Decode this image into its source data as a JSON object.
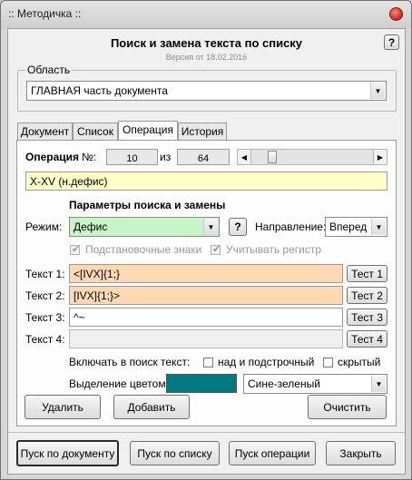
{
  "window": {
    "title": ":: Методичка ::"
  },
  "header": {
    "title": "Поиск и замена текста по списку",
    "version": "Версия от 18.02.2016",
    "help_label": "?"
  },
  "scope": {
    "group_label": "Область",
    "value": "ГЛАВНАЯ часть документа"
  },
  "tabs": [
    {
      "label": "Документ"
    },
    {
      "label": "Список"
    },
    {
      "label": "Операция"
    },
    {
      "label": "История"
    }
  ],
  "operation": {
    "label": "Операция",
    "number_label": "№:",
    "current": "10",
    "of_label": "из",
    "total": "64",
    "slider_fraction": 0.14,
    "name": "X-XV (н.дефис)"
  },
  "params": {
    "title": "Параметры поиска и замены",
    "mode_label": "Режим:",
    "mode_value": "Дефис",
    "help_label": "?",
    "direction_label": "Направление:",
    "direction_value": "Вперед",
    "wildcards_label": "Подстановочные знаки",
    "match_case_label": "Учитывать регистр"
  },
  "texts": [
    {
      "label": "Текст 1:",
      "value": "<[IVX]{1;}",
      "test_label": "Тест 1"
    },
    {
      "label": "Текст 2:",
      "value": "[IVX]{1;}>",
      "test_label": "Тест 2"
    },
    {
      "label": "Текст 3:",
      "value": "^~",
      "test_label": "Тест 3"
    },
    {
      "label": "Текст 4:",
      "value": "",
      "test_label": "Тест 4"
    }
  ],
  "include": {
    "label": "Включать в поиск текст:",
    "superscript_label": "над и подстрочный",
    "hidden_label": "скрытый"
  },
  "highlight": {
    "label": "Выделение цветом:",
    "swatch_color": "#007a80",
    "value": "Сине-зеленый"
  },
  "actions": {
    "delete": "Удалить",
    "add": "Добавить",
    "clear": "Очистить"
  },
  "footer": {
    "run_document": "Пуск по документу",
    "run_list": "Пуск по списку",
    "run_operation": "Пуск операции",
    "close": "Закрыть"
  },
  "colors": {
    "name_field": "#ffffc8",
    "mode_field": "#c8f5c8",
    "text_field": "#ffd9b3"
  }
}
